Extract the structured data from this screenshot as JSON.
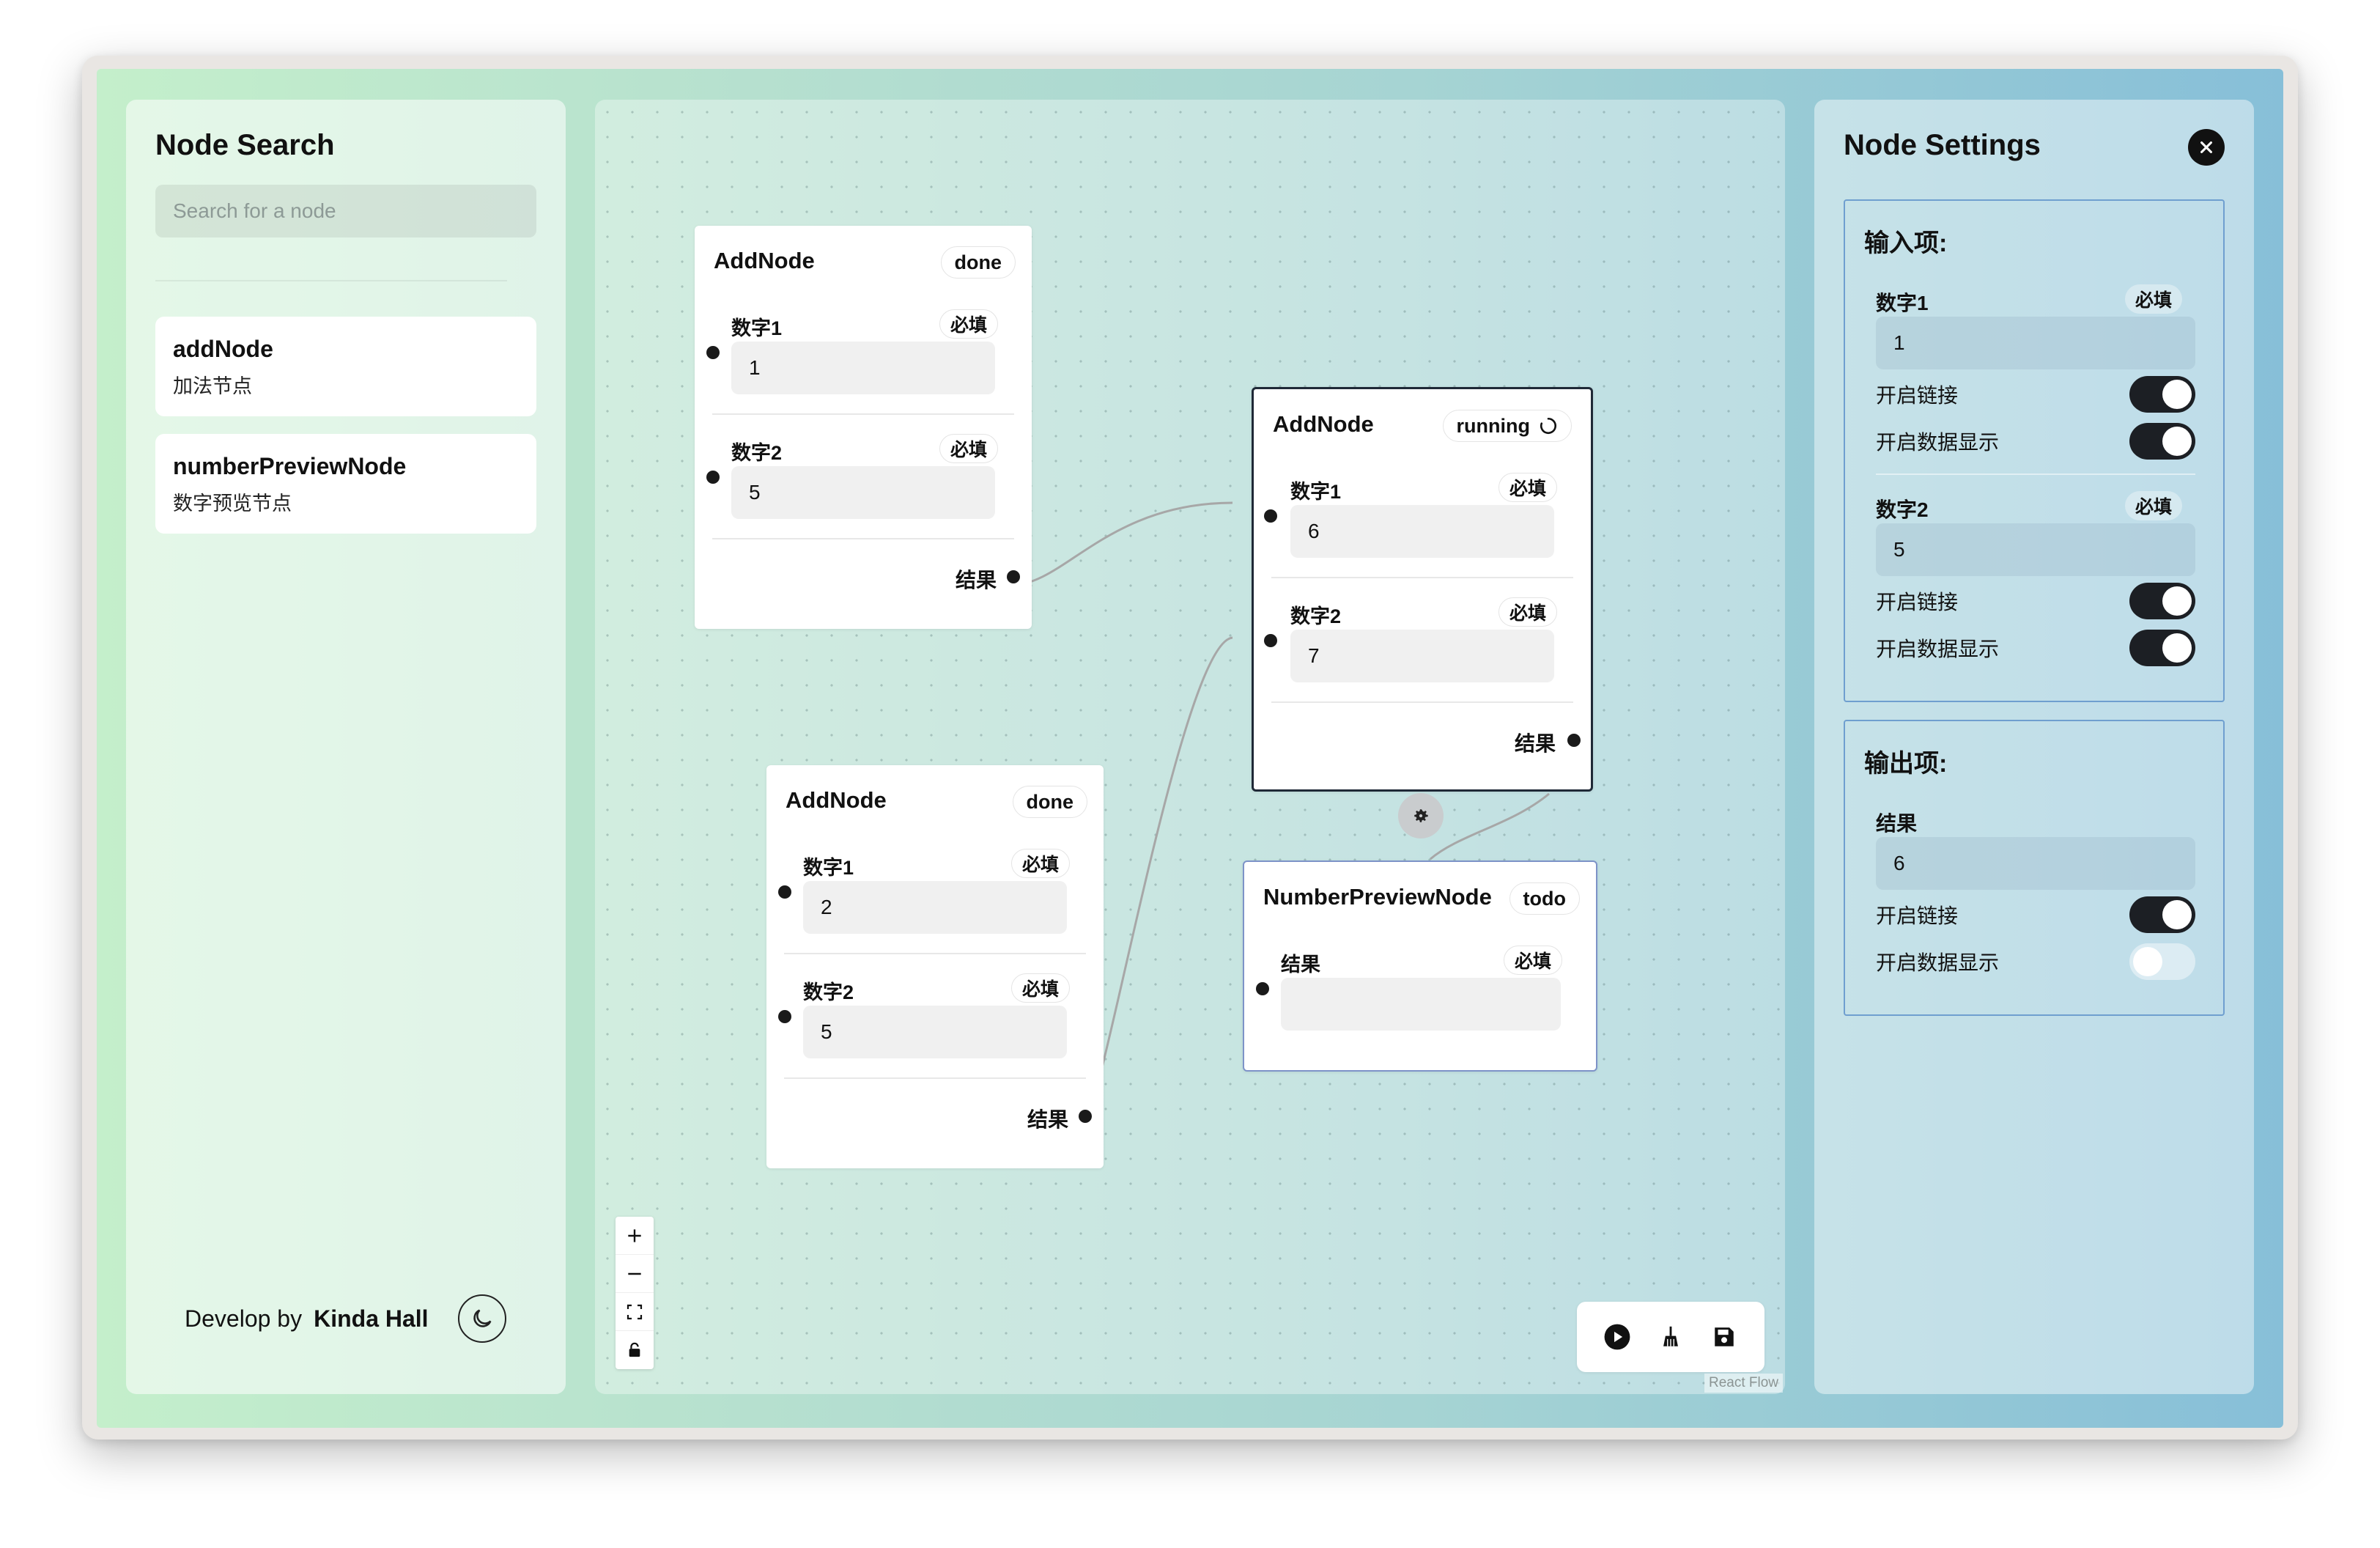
{
  "left_panel": {
    "title": "Node Search",
    "search_placeholder": "Search for a node",
    "items": [
      {
        "name": "addNode",
        "desc": "加法节点"
      },
      {
        "name": "numberPreviewNode",
        "desc": "数字预览节点"
      }
    ],
    "footer": {
      "develop_by": "Develop by",
      "author": "Kinda Hall",
      "theme_icon": "moon-icon"
    }
  },
  "canvas": {
    "nodes": [
      {
        "title": "AddNode",
        "status": "done",
        "fields": [
          {
            "label": "数字1",
            "required": "必填",
            "value": "1"
          },
          {
            "label": "数字2",
            "required": "必填",
            "value": "5"
          }
        ],
        "output": "结果"
      },
      {
        "title": "AddNode",
        "status": "done",
        "fields": [
          {
            "label": "数字1",
            "required": "必填",
            "value": "2"
          },
          {
            "label": "数字2",
            "required": "必填",
            "value": "5"
          }
        ],
        "output": "结果"
      },
      {
        "title": "AddNode",
        "status": "running",
        "fields": [
          {
            "label": "数字1",
            "required": "必填",
            "value": "6"
          },
          {
            "label": "数字2",
            "required": "必填",
            "value": "7"
          }
        ],
        "output": "结果"
      },
      {
        "title": "NumberPreviewNode",
        "status": "todo",
        "fields": [
          {
            "label": "结果",
            "required": "必填",
            "value": ""
          }
        ]
      }
    ],
    "zoom_controls": [
      "zoom-in-icon",
      "zoom-out-icon",
      "fit-view-icon",
      "lock-icon"
    ],
    "toolbar": [
      "play-icon",
      "broom-icon",
      "save-icon"
    ],
    "attribution": "React Flow"
  },
  "right_panel": {
    "title": "Node Settings",
    "input_section": {
      "title": "输入项:",
      "items": [
        {
          "label": "数字1",
          "required": "必填",
          "value": "1",
          "toggle1_label": "开启链接",
          "toggle1": true,
          "toggle2_label": "开启数据显示",
          "toggle2": true
        },
        {
          "label": "数字2",
          "required": "必填",
          "value": "5",
          "toggle1_label": "开启链接",
          "toggle1": true,
          "toggle2_label": "开启数据显示",
          "toggle2": true
        }
      ]
    },
    "output_section": {
      "title": "输出项:",
      "items": [
        {
          "label": "结果",
          "value": "6",
          "toggle1_label": "开启链接",
          "toggle1": true,
          "toggle2_label": "开启数据显示",
          "toggle2": false
        }
      ]
    }
  }
}
